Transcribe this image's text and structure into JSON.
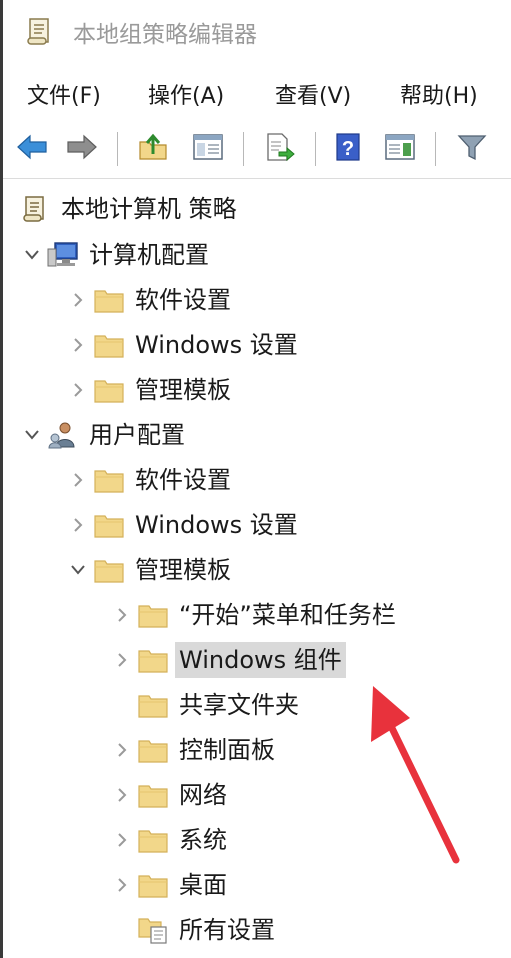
{
  "window": {
    "title": "本地组策略编辑器"
  },
  "menu": {
    "items": [
      "文件(F)",
      "操作(A)",
      "查看(V)",
      "帮助(H)"
    ]
  },
  "toolbar": {
    "buttons": [
      "back-icon",
      "forward-icon",
      "up-folder-icon",
      "show-hide-tree-icon",
      "export-list-icon",
      "help-icon",
      "properties-pane-icon",
      "filter-icon"
    ]
  },
  "tree": {
    "root": "本地计算机 策略",
    "computer_config": {
      "label": "计算机配置",
      "children": [
        "软件设置",
        "Windows 设置",
        "管理模板"
      ]
    },
    "user_config": {
      "label": "用户配置",
      "children": [
        "软件设置",
        "Windows 设置",
        "管理模板"
      ]
    },
    "admin_templates_children": [
      "“开始”菜单和任务栏",
      "Windows 组件",
      "共享文件夹",
      "控制面板",
      "网络",
      "系统",
      "桌面",
      "所有设置"
    ],
    "selected": "Windows 组件"
  },
  "colors": {
    "folder": "#f2d78a",
    "folder_edge": "#d4b15a",
    "arrow": "#e8323c",
    "selection": "#d9d9d9"
  }
}
